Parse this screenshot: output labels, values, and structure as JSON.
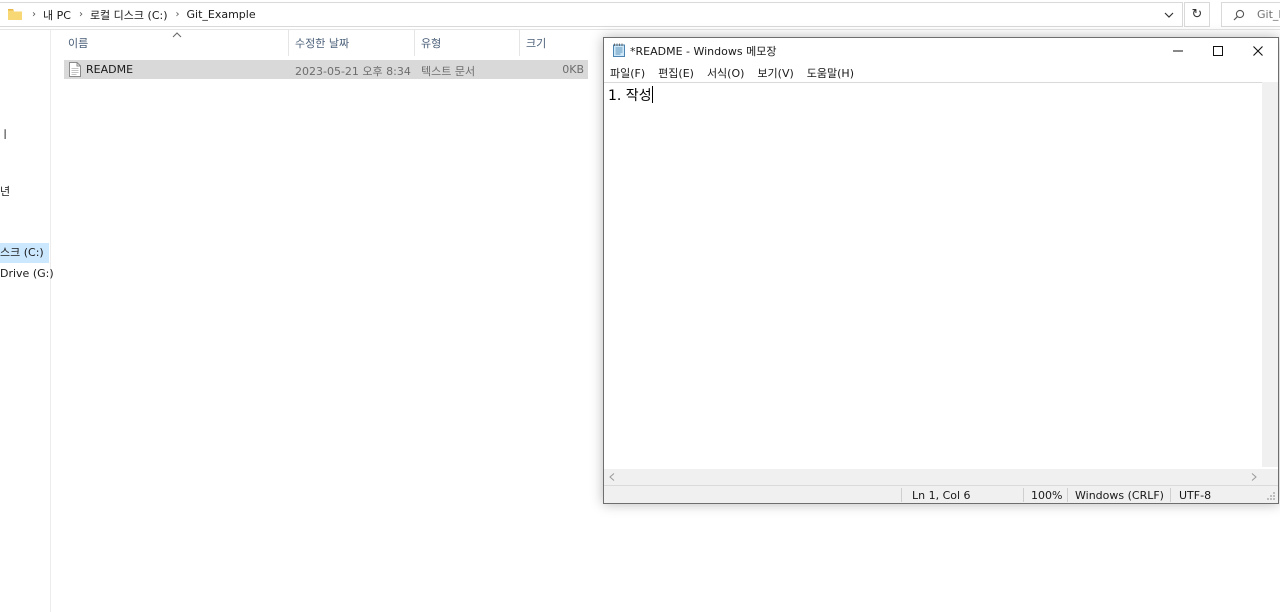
{
  "explorer": {
    "breadcrumbs": [
      "내 PC",
      "로컬 디스크 (C:)",
      "Git_Example"
    ],
    "search_placeholder": "Git_Ex",
    "refresh_glyph": "↻",
    "nav_fragments": [
      "",
      "",
      "",
      "",
      "",
      "스크 (C:)",
      "Drive (G:)"
    ],
    "columns": {
      "name": "이름",
      "date": "수정한 날짜",
      "type": "유형",
      "size": "크기"
    },
    "files": [
      {
        "name": "README",
        "date": "2023-05-21 오후 8:34",
        "type": "텍스트 문서",
        "size": "0KB"
      }
    ]
  },
  "notepad": {
    "title": "*README - Windows 메모장",
    "menu": [
      "파일(F)",
      "편집(E)",
      "서식(O)",
      "보기(V)",
      "도움말(H)"
    ],
    "content": "1. 작성",
    "status": {
      "position": "Ln 1, Col 6",
      "zoom": "100%",
      "line_ending": "Windows (CRLF)",
      "encoding": "UTF-8"
    }
  },
  "colors": {
    "accent": "#cce8ff",
    "selected_row": "#d9d9d9",
    "header_text": "#4c607a"
  }
}
